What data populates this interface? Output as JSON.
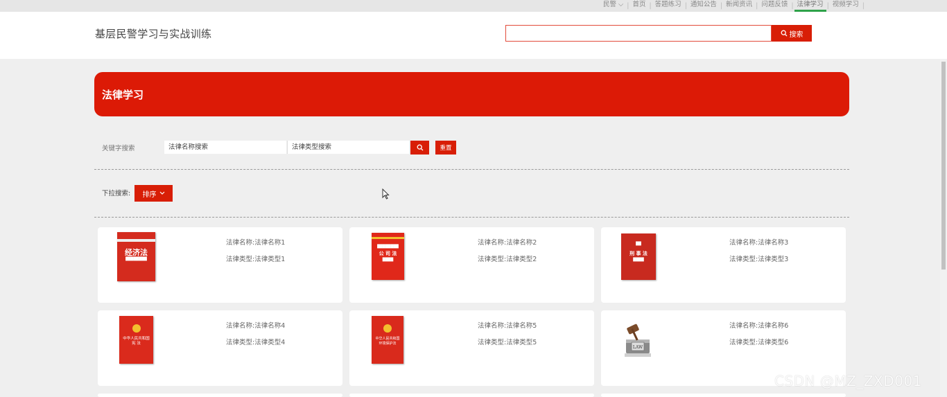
{
  "topnav": {
    "user": "民警",
    "items": [
      "首页",
      "答题练习",
      "通知公告",
      "新闻资讯",
      "问题反馈",
      "法律学习",
      "视频学习"
    ],
    "active_index": 5,
    "separator": "|"
  },
  "header": {
    "site_title": "基层民警学习与实战训练",
    "search_value": "",
    "search_button": "搜索"
  },
  "banner": {
    "title": "法律学习"
  },
  "keyword_search": {
    "label": "关键字搜索",
    "name_placeholder": "法律名称搜索",
    "type_placeholder": "法律类型搜索",
    "reset_button": "重置"
  },
  "dropdown_search": {
    "label": "下拉搜索:",
    "sort_button": "排序"
  },
  "cards": [
    {
      "name": "法律名称:法律名称1",
      "type": "法律类型:法律类型1",
      "cover": "经济法 book cover"
    },
    {
      "name": "法律名称:法律名称2",
      "type": "法律类型:法律类型2",
      "cover": "公司法 book cover"
    },
    {
      "name": "法律名称:法律名称3",
      "type": "法律类型:法律类型3",
      "cover": "刑事法 book cover"
    },
    {
      "name": "法律名称:法律名称4",
      "type": "法律类型:法律类型4",
      "cover": "中华人民共和国宪法 book cover"
    },
    {
      "name": "法律名称:法律名称5",
      "type": "法律类型:法律类型5",
      "cover": "中华人民共和国环境保护法 book cover"
    },
    {
      "name": "法律名称:法律名称6",
      "type": "法律类型:法律类型6",
      "cover": "LAW gavel image"
    }
  ],
  "watermark": "CSDN @MZ_ZXD001",
  "colors": {
    "primary": "#d81e06",
    "active_tab_underline": "#2fa24a",
    "background": "#efefef"
  }
}
